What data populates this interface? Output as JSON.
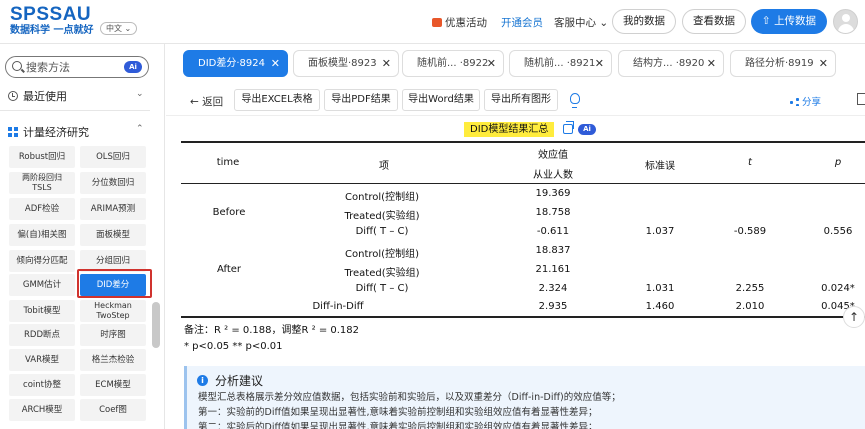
{
  "header": {
    "logo_main": "SPSSAU",
    "logo_sub": "数据科学 一点就好",
    "lang": "中文 ⌄",
    "promo": "优惠活动",
    "vip": "开通会员",
    "customer": "客服中心 ⌄",
    "my_data": "我的数据",
    "view_data": "查看数据",
    "upload": "上传数据"
  },
  "sidebar": {
    "search_placeholder": "搜索方法",
    "ai": "Ai",
    "recent": "最近使用",
    "category": "计量经济研究",
    "methods": [
      "Robust回归",
      "OLS回归",
      "两阶段回归 TSLS",
      "分位数回归",
      "ADF检验",
      "ARIMA预测",
      "偏(自)相关图",
      "面板模型",
      "倾向得分匹配",
      "分组回归",
      "GMM估计",
      "DID差分",
      "Tobit模型",
      "Heckman TwoStep",
      "RDD断点",
      "时序图",
      "VAR模型",
      "格兰杰检验",
      "coint协整",
      "ECM模型",
      "ARCH模型",
      "Coef图"
    ]
  },
  "tabs": [
    {
      "label": "DID差分·8924"
    },
    {
      "label": "面板模型·8923"
    },
    {
      "label": "随机前... ·8922"
    },
    {
      "label": "随机前... ·8921"
    },
    {
      "label": "结构方... ·8920"
    },
    {
      "label": "路径分析·8919"
    }
  ],
  "toolbar": {
    "back": "← 返回",
    "export_excel": "导出EXCEL表格",
    "export_pdf": "导出PDF结果",
    "export_word": "导出Word结果",
    "export_img": "导出所有图形",
    "share": "分享"
  },
  "result": {
    "title": "DID模型结果汇总",
    "ai": "Ai",
    "headers": {
      "time": "time",
      "item": "项",
      "effect": "效应值",
      "effect_sub": "从业人数",
      "se": "标准误",
      "t": "t",
      "p": "p"
    },
    "rows": [
      {
        "time": "",
        "item": "Control(控制组)",
        "effect": "19.369",
        "se": "",
        "t": "",
        "p": ""
      },
      {
        "time": "Before",
        "item": "Treated(实验组)",
        "effect": "18.758",
        "se": "",
        "t": "",
        "p": ""
      },
      {
        "time": "",
        "item": "Diff( T – C)",
        "effect": "-0.611",
        "se": "1.037",
        "t": "-0.589",
        "p": "0.556"
      },
      {
        "time": "",
        "item": "Control(控制组)",
        "effect": "18.837",
        "se": "",
        "t": "",
        "p": ""
      },
      {
        "time": "After",
        "item": "Treated(实验组)",
        "effect": "21.161",
        "se": "",
        "t": "",
        "p": ""
      },
      {
        "time": "",
        "item": "Diff( T – C)",
        "effect": "2.324",
        "se": "1.031",
        "t": "2.255",
        "p": "0.024*"
      },
      {
        "time": "",
        "item": "Diff-in-Diff",
        "effect": "2.935",
        "se": "1.460",
        "t": "2.010",
        "p": "0.045*"
      }
    ],
    "note1": "备注：R ² = 0.188，调整R ² = 0.182",
    "note2": "* p<0.05 ** p<0.01"
  },
  "analysis": {
    "title": "分析建议",
    "lines": [
      "模型汇总表格展示差分效应值数据，包括实验前和实验后，以及双重差分（Diff-in-Diff)的效应值等；",
      "第一：实验前的Diff值如果呈现出显著性,意味着实验前控制组和实验组效应值有着显著性差异；",
      "第二：实验后的Diff值如果呈现出显著性,意味着实验后控制组和实验组效应值有着显著性差异；"
    ]
  },
  "colors": {
    "brand": "#1e7be6",
    "highlight": "#ffec3d",
    "outline_red": "#d0332e"
  }
}
